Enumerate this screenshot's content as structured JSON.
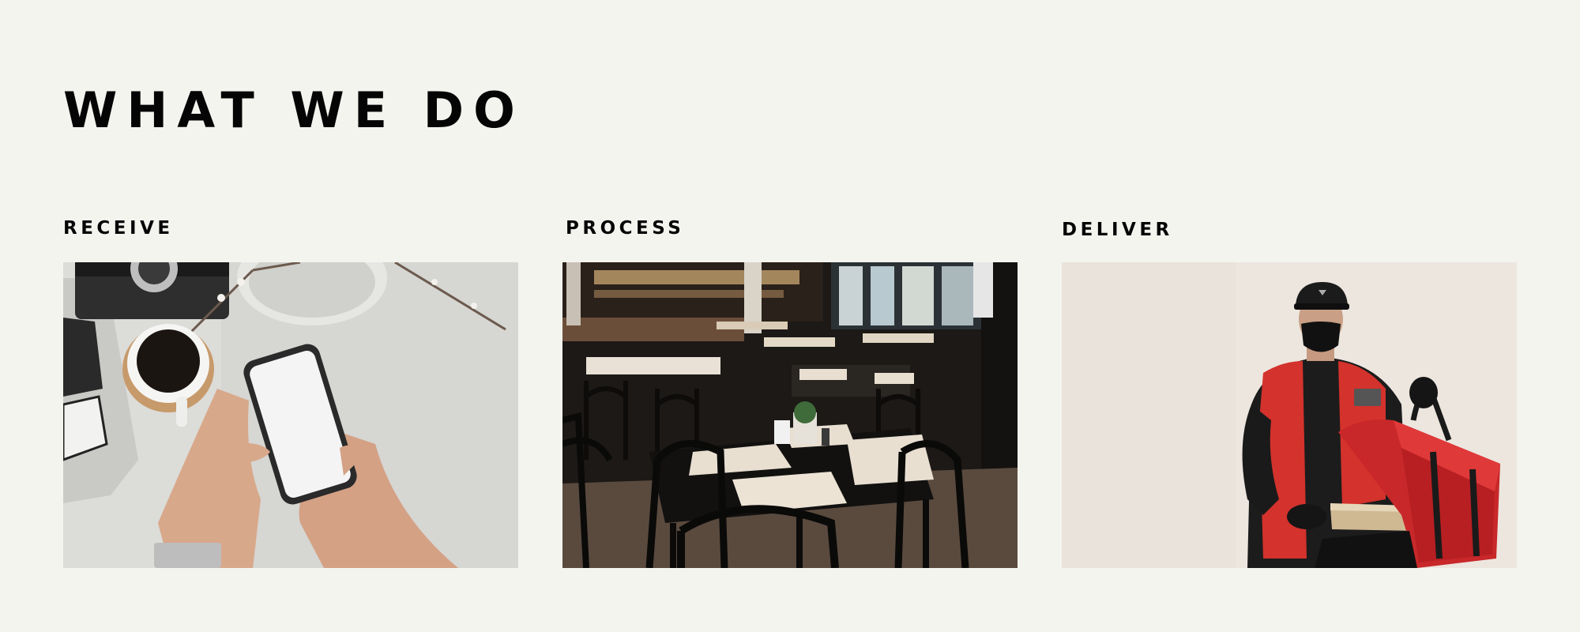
{
  "section": {
    "title": "WHAT WE DO"
  },
  "cards": [
    {
      "label": "RECEIVE",
      "image": "hands-holding-smartphone-with-coffee-photo"
    },
    {
      "label": "PROCESS",
      "image": "restaurant-interior-with-tables-photo"
    },
    {
      "label": "DELIVER",
      "image": "courier-with-red-delivery-bag-photo"
    }
  ],
  "colors": {
    "background": "#f4f4ef",
    "text": "#050505",
    "courier_vest": "#d4322c"
  }
}
